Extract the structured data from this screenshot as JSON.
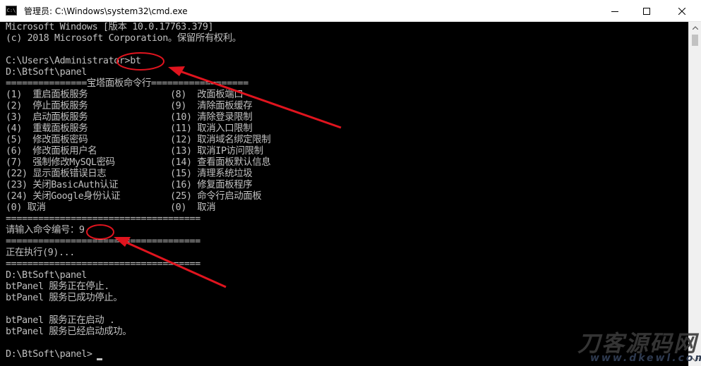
{
  "window": {
    "title": "管理员: C:\\Windows\\system32\\cmd.exe",
    "icon_label": "C:\\"
  },
  "console": {
    "lines": [
      "Microsoft Windows [版本 10.0.17763.379]",
      "(c) 2018 Microsoft Corporation。保留所有权利。",
      "",
      "C:\\Users\\Administrator>bt",
      "D:\\BtSoft\\panel",
      "===============宝塔面板命令行==================",
      "",
      "",
      "",
      "",
      "",
      "",
      "",
      "",
      "",
      "",
      "",
      "====================================",
      "请输入命令编号：9",
      "====================================",
      "正在执行(9)...",
      "====================================",
      "D:\\BtSoft\\panel",
      "btPanel 服务正在停止.",
      "btPanel 服务已成功停止。",
      "",
      "btPanel 服务正在启动 .",
      "btPanel 服务已经启动成功。",
      "",
      "D:\\BtSoft\\panel>"
    ],
    "menu": [
      [
        "(1)  重启面板服务",
        "(8)  改面板端口"
      ],
      [
        "(2)  停止面板服务",
        "(9)  清除面板缓存"
      ],
      [
        "(3)  启动面板服务",
        "(10) 清除登录限制"
      ],
      [
        "(4)  重载面板服务",
        "(11) 取消入口限制"
      ],
      [
        "(5)  修改面板密码",
        "(12) 取消域名绑定限制"
      ],
      [
        "(6)  修改面板用户名",
        "(13) 取消IP访问限制"
      ],
      [
        "(7)  强制修改MySQL密码",
        "(14) 查看面板默认信息"
      ],
      [
        "(22) 显示面板错误日志",
        "(15) 清理系统垃圾"
      ],
      [
        "(23) 关闭BasicAuth认证",
        "(16) 修复面板程序"
      ],
      [
        "(24) 关闭Google身份认证",
        "(25) 命令行启动面板"
      ],
      [
        "(0) 取消",
        "(0)  取消"
      ]
    ]
  },
  "watermark": {
    "text": "刀客源码网",
    "url": "www.dkewl.com"
  },
  "colors": {
    "console_bg": "#000000",
    "console_fg": "#c0c0c0",
    "annotation": "#e0141e"
  }
}
